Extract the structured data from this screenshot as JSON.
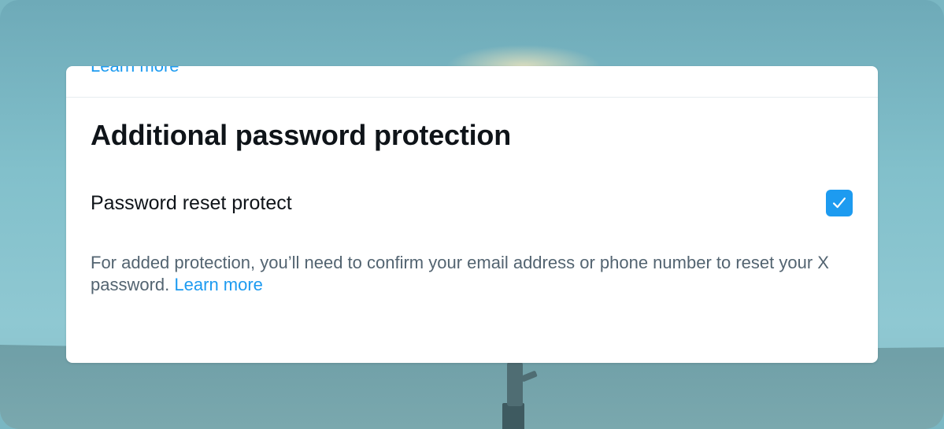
{
  "previous_section": {
    "link_label": "Learn more"
  },
  "section": {
    "title": "Additional password protection",
    "setting": {
      "label": "Password reset protect",
      "checked": true
    },
    "description": "For added protection, you’ll need to confirm your email address or phone number to reset your X password.",
    "learn_more_label": "Learn more"
  },
  "colors": {
    "accent": "#1d9bf0",
    "heading_text": "#0f1419",
    "secondary_text": "#536471"
  },
  "icons": {
    "checkbox": "checkmark-icon"
  }
}
